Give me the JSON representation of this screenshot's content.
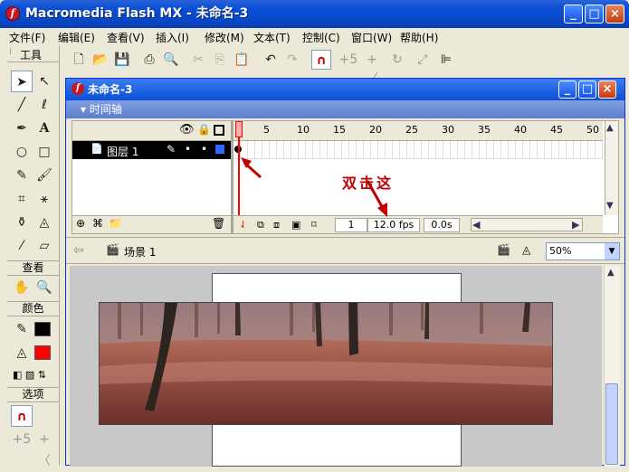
{
  "app": {
    "title": "Macromedia Flash MX - 未命名-3",
    "logo_letter": "f",
    "controls": {
      "minimize": "_",
      "maximize": "□",
      "close": "×"
    }
  },
  "menu": [
    "文件(F)",
    "编辑(E)",
    "查看(V)",
    "插入(I)",
    "修改(M)",
    "文本(T)",
    "控制(C)",
    "窗口(W)",
    "帮助(H)"
  ],
  "tools": {
    "title": "工具",
    "items": [
      "arrow-icon",
      "subselect-icon",
      "line-icon",
      "lasso-icon",
      "pen-icon",
      "text-icon",
      "oval-icon",
      "rect-icon",
      "pencil-icon",
      "brush-icon",
      "free-transform-icon",
      "fill-transform-icon",
      "ink-bottle-icon",
      "paint-bucket-icon",
      "eyedropper-icon",
      "eraser-icon"
    ],
    "view_label": "查看",
    "color_label": "颜色",
    "options_label": "选项",
    "stroke_color": "#000000",
    "fill_color": "#ff0000"
  },
  "toolbar": [
    "new-icon",
    "open-icon",
    "save-icon",
    "print-icon",
    "print-preview-icon",
    "cut-icon",
    "copy-icon",
    "paste-icon",
    "undo-icon",
    "redo-icon",
    "snap-magnet-icon",
    "smooth-icon",
    "straighten-icon",
    "rotate-icon",
    "scale-icon",
    "align-icon"
  ],
  "document": {
    "title": "未命名-3",
    "timeline_label": "▾ 时间轴",
    "ruler": [
      "1",
      "5",
      "10",
      "15",
      "20",
      "25",
      "30",
      "35",
      "40",
      "45",
      "50"
    ],
    "layer_name": "图层 1",
    "current_frame": "1",
    "fps": "12.0 fps",
    "elapsed": "0.0s",
    "scene": "场景 1",
    "zoom": "50%"
  },
  "annotation": "双击这",
  "accent_colors": {
    "title_blue": "#0a4fd6",
    "annotation_red": "#c00000",
    "playhead": "#ff0000"
  }
}
